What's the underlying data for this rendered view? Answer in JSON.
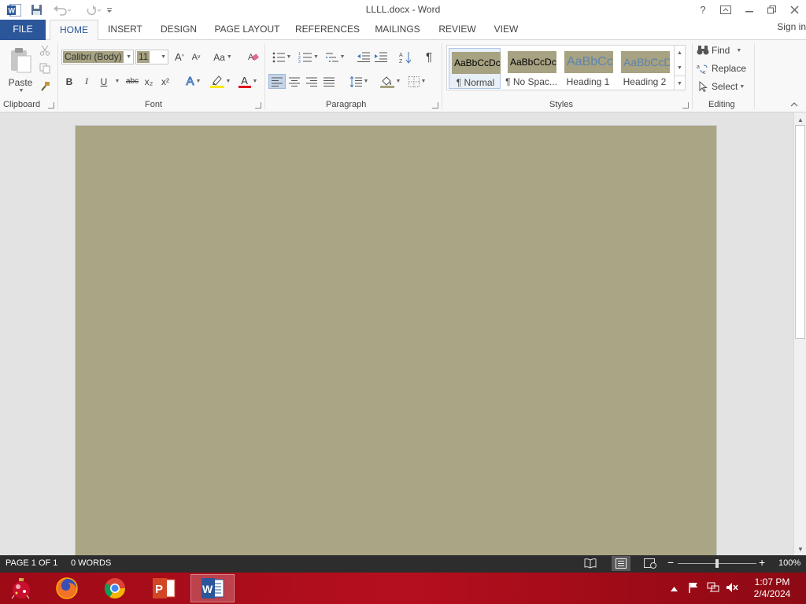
{
  "window": {
    "title": "LLLL.docx - Word",
    "help": "?",
    "sign_in": "Sign in"
  },
  "tabs": [
    "FILE",
    "HOME",
    "INSERT",
    "DESIGN",
    "PAGE LAYOUT",
    "REFERENCES",
    "MAILINGS",
    "REVIEW",
    "VIEW"
  ],
  "ribbon": {
    "clipboard": {
      "label": "Clipboard",
      "paste": "Paste"
    },
    "font": {
      "label": "Font",
      "font_name": "Calibri (Body)",
      "font_size": "11",
      "change_case": "Aa",
      "bold": "B",
      "italic": "I",
      "underline": "U",
      "strikethrough": "abc",
      "subscript": "x₂",
      "superscript": "x²",
      "grow": "A",
      "shrink": "A",
      "text_effects": "A",
      "font_color": "A"
    },
    "paragraph": {
      "label": "Paragraph",
      "pilcrow": "¶"
    },
    "styles": {
      "label": "Styles",
      "items": [
        {
          "preview": "AaBbCcDc",
          "name": "¶ Normal",
          "color": "#000000"
        },
        {
          "preview": "AaBbCcDc",
          "name": "¶ No Spac...",
          "color": "#000000"
        },
        {
          "preview": "AaBbCc",
          "name": "Heading 1",
          "color": "#5b84b1"
        },
        {
          "preview": "AaBbCcD",
          "name": "Heading 2",
          "color": "#5b84b1"
        }
      ]
    },
    "editing": {
      "label": "Editing",
      "find": "Find",
      "replace": "Replace",
      "select": "Select"
    }
  },
  "status": {
    "page": "PAGE 1 OF 1",
    "words": "0 WORDS",
    "zoom": "100%",
    "zoom_level": 0.5
  },
  "taskbar": {
    "time": "1:07 PM",
    "date": "2/4/2024",
    "apps": [
      "firefox",
      "chrome",
      "powerpoint",
      "word"
    ]
  },
  "colors": {
    "accent": "#2b579a",
    "page_fill": "#aaa584",
    "status_bar": "#2d2d2d",
    "taskbar": "#b50f1e"
  }
}
